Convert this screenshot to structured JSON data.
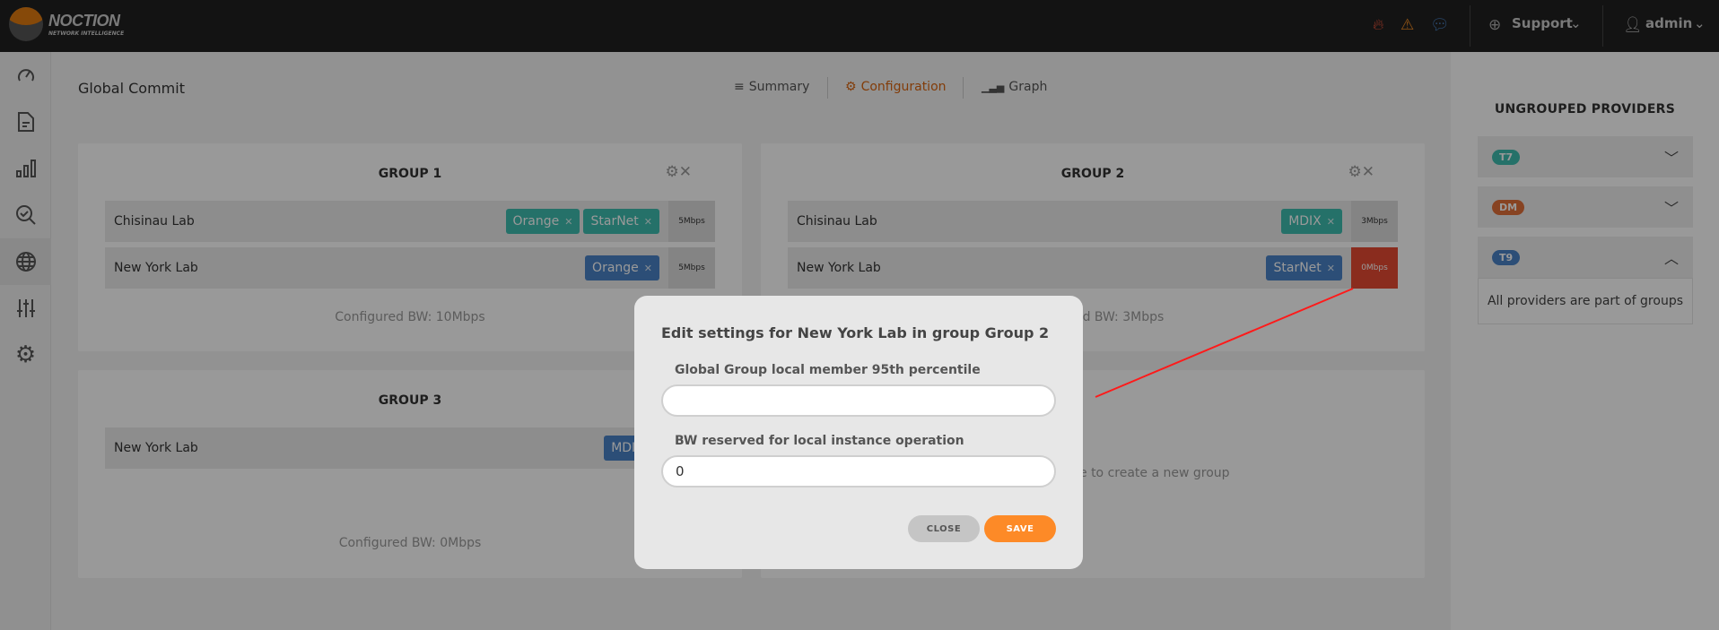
{
  "brand": {
    "name": "NOCTION",
    "tagline": "NETWORK INTELLIGENCE",
    "accent": "#e07a10"
  },
  "header": {
    "icons": [
      "fire-icon",
      "warning-icon",
      "chat-icon"
    ],
    "support_label": "Support",
    "user_label": "admin"
  },
  "sidebar": {
    "items": [
      "dashboard-icon",
      "reports-icon",
      "graphs-icon",
      "search-check-icon",
      "globe-icon",
      "sliders-icon",
      "settings-icon"
    ],
    "active": "globe-icon"
  },
  "page": {
    "title": "Global Commit",
    "tabs": [
      {
        "label": "Summary",
        "active": false
      },
      {
        "label": "Configuration",
        "active": true
      },
      {
        "label": "Graph",
        "active": false
      }
    ]
  },
  "groups": [
    {
      "title": "GROUP 1",
      "rows": [
        {
          "name": "Chisinau Lab",
          "tags": [
            {
              "label": "Orange",
              "color": "teal"
            },
            {
              "label": "StarNet",
              "color": "teal"
            }
          ],
          "bw": "5Mbps"
        },
        {
          "name": "New York Lab",
          "tags": [
            {
              "label": "Orange",
              "color": "blue"
            }
          ],
          "bw": "5Mbps"
        }
      ],
      "configured": "Configured BW: 10Mbps"
    },
    {
      "title": "GROUP 2",
      "rows": [
        {
          "name": "Chisinau Lab",
          "tags": [
            {
              "label": "MDIX",
              "color": "teal"
            }
          ],
          "bw": "3Mbps"
        },
        {
          "name": "New York Lab",
          "tags": [
            {
              "label": "StarNet",
              "color": "blue"
            }
          ],
          "bw": "0Mbps",
          "alert": true
        }
      ],
      "configured": "Configured BW: 3Mbps"
    },
    {
      "title": "GROUP 3",
      "rows": [
        {
          "name": "New York Lab",
          "tags": [
            {
              "label": "MDIX",
              "color": "blue"
            }
          ],
          "bw": ""
        }
      ],
      "configured": "Configured BW: 0Mbps"
    }
  ],
  "new_group_hint": "e to create a new group",
  "ungrouped": {
    "title": "UNGROUPED PROVIDERS",
    "items": [
      {
        "label": "T7",
        "color": "#3fbcb0",
        "expanded": false
      },
      {
        "label": "DM",
        "color": "#e2703a",
        "expanded": false
      },
      {
        "label": "T9",
        "color": "#4a83c6",
        "expanded": true
      }
    ],
    "empty_text": "All providers are part of groups"
  },
  "modal": {
    "title": "Edit settings for New York Lab in group Group 2",
    "field1_label": "Global Group local member 95th percentile",
    "field1_value": "",
    "field2_label": "BW reserved for local instance operation",
    "field2_value": "0",
    "close_label": "CLOSE",
    "save_label": "SAVE"
  }
}
